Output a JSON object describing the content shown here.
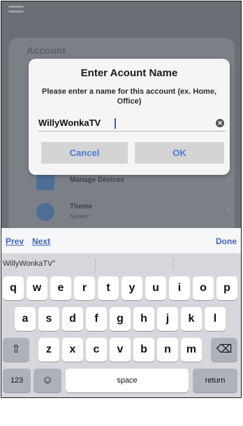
{
  "background": {
    "card_title": "Account",
    "rows": [
      {
        "label": "Manage Devices",
        "sub": ""
      },
      {
        "label": "Theme",
        "sub": "System"
      }
    ]
  },
  "dialog": {
    "title": "Enter Acount Name",
    "message": "Please enter a name for this account (ex. Home, Office)",
    "input_value": "WillyWonkaTV",
    "cancel_label": "Cancel",
    "ok_label": "OK"
  },
  "accessory": {
    "prev_label": "Prev",
    "next_label": "Next",
    "done_label": "Done"
  },
  "keyboard": {
    "suggestion": "WillyWonkaTV\"",
    "row1": [
      "q",
      "w",
      "e",
      "r",
      "t",
      "y",
      "u",
      "i",
      "o",
      "p"
    ],
    "row2": [
      "a",
      "s",
      "d",
      "f",
      "g",
      "h",
      "j",
      "k",
      "l"
    ],
    "row3": [
      "z",
      "x",
      "c",
      "v",
      "b",
      "n",
      "m"
    ],
    "shift_symbol": "⇧",
    "backspace_symbol": "⌫",
    "numbers_label": "123",
    "emoji_symbol": "☺",
    "space_label": "space",
    "return_label": "return"
  },
  "colors": {
    "accent": "#3f63c4",
    "dialog_button_text": "#4a7bd0",
    "dialog_button_bg": "#d4d4d4",
    "keyboard_bg": "#d5d7dd",
    "dim_overlay": "#6b6f75"
  }
}
